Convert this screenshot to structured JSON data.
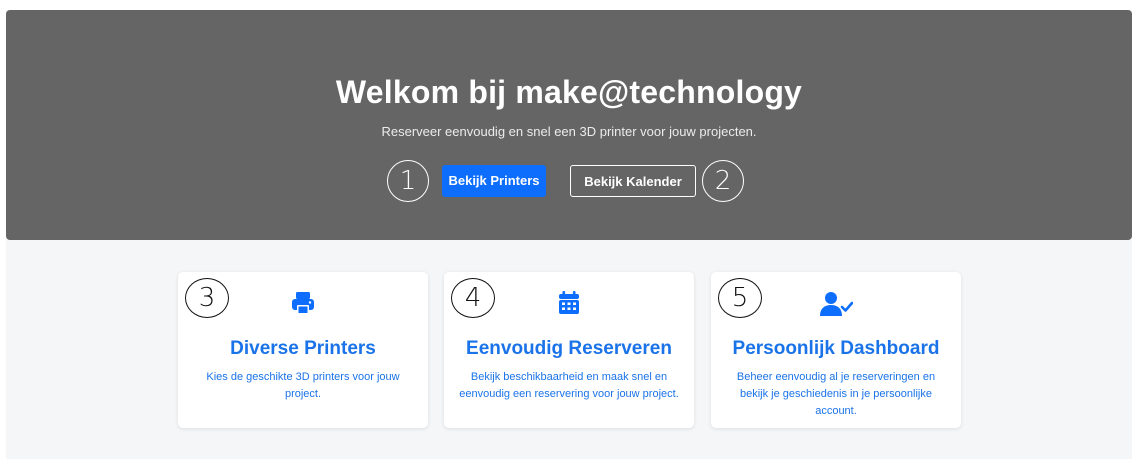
{
  "hero": {
    "title": "Welkom bij make@technology",
    "subtitle": "Reserveer eenvoudig en snel een 3D printer voor jouw projecten.",
    "primary_button": "Bekijk Printers",
    "secondary_button": "Bekijk Kalender",
    "marker_left": "1",
    "marker_right": "2"
  },
  "features": [
    {
      "marker": "3",
      "icon": "printer-icon",
      "title": "Diverse Printers",
      "text": "Kies de geschikte 3D printers voor jouw project."
    },
    {
      "marker": "4",
      "icon": "calendar-icon",
      "title": "Eenvoudig Reserveren",
      "text": "Bekijk beschikbaarheid en maak snel en eenvoudig een reservering voor jouw project."
    },
    {
      "marker": "5",
      "icon": "user-check-icon",
      "title": "Persoonlijk Dashboard",
      "text": "Beheer eenvoudig al je reserveringen en bekijk je geschiedenis in je persoonlijke account."
    }
  ],
  "colors": {
    "hero_bg": "#646564",
    "accent": "#0d6efd",
    "feature_text": "#1a73e8",
    "page_bg": "#f5f6f8"
  }
}
